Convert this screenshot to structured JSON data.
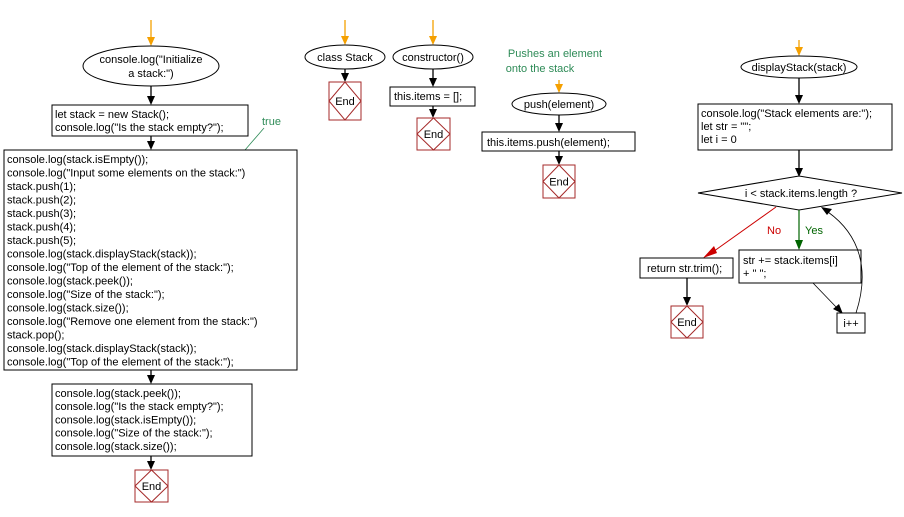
{
  "colors": {
    "start_arrow": "#f5a000",
    "end_border": "#a52a2a",
    "yes": "#006400",
    "no": "#cc0000",
    "note": "#2e8b57"
  },
  "main": {
    "start": [
      "console.log(\"Initialize",
      "a stack:\")"
    ],
    "box1": [
      "let stack = new Stack();",
      "console.log(\"Is the stack empty?\");"
    ],
    "true_label": "true",
    "box2": [
      "console.log(stack.isEmpty());",
      "console.log(\"Input some elements on the stack:\")",
      "stack.push(1);",
      "stack.push(2);",
      "stack.push(3);",
      "stack.push(4);",
      "stack.push(5);",
      "console.log(stack.displayStack(stack));",
      "console.log(\"Top of the element of the stack:\");",
      "console.log(stack.peek());",
      "console.log(\"Size of the stack:\");",
      "console.log(stack.size());",
      "console.log(\"Remove one element from the stack:\")",
      "stack.pop();",
      "console.log(stack.displayStack(stack));",
      "console.log(\"Top of the element of the stack:\");"
    ],
    "box3": [
      "console.log(stack.peek());",
      "console.log(\"Is the stack empty?\");",
      "console.log(stack.isEmpty());",
      "console.log(\"Size of the stack:\");",
      "console.log(stack.size());"
    ],
    "end": "End"
  },
  "class_stack": {
    "start": "class Stack",
    "end": "End"
  },
  "constructor": {
    "start": "constructor()",
    "body": "this.items = [];",
    "end": "End"
  },
  "push": {
    "note": [
      "Pushes an element",
      "onto the stack"
    ],
    "start": "push(element)",
    "body": "this.items.push(element);",
    "end": "End"
  },
  "display": {
    "start": "displayStack(stack)",
    "init": [
      "console.log(\"Stack elements are:\");",
      "let str = \"\";",
      "let i = 0"
    ],
    "condition": "i < stack.items.length ?",
    "no": "No",
    "yes": "Yes",
    "return": "return str.trim();",
    "body": [
      "str += stack.items[i]",
      "+ \" \";"
    ],
    "inc": "i++",
    "end": "End"
  }
}
